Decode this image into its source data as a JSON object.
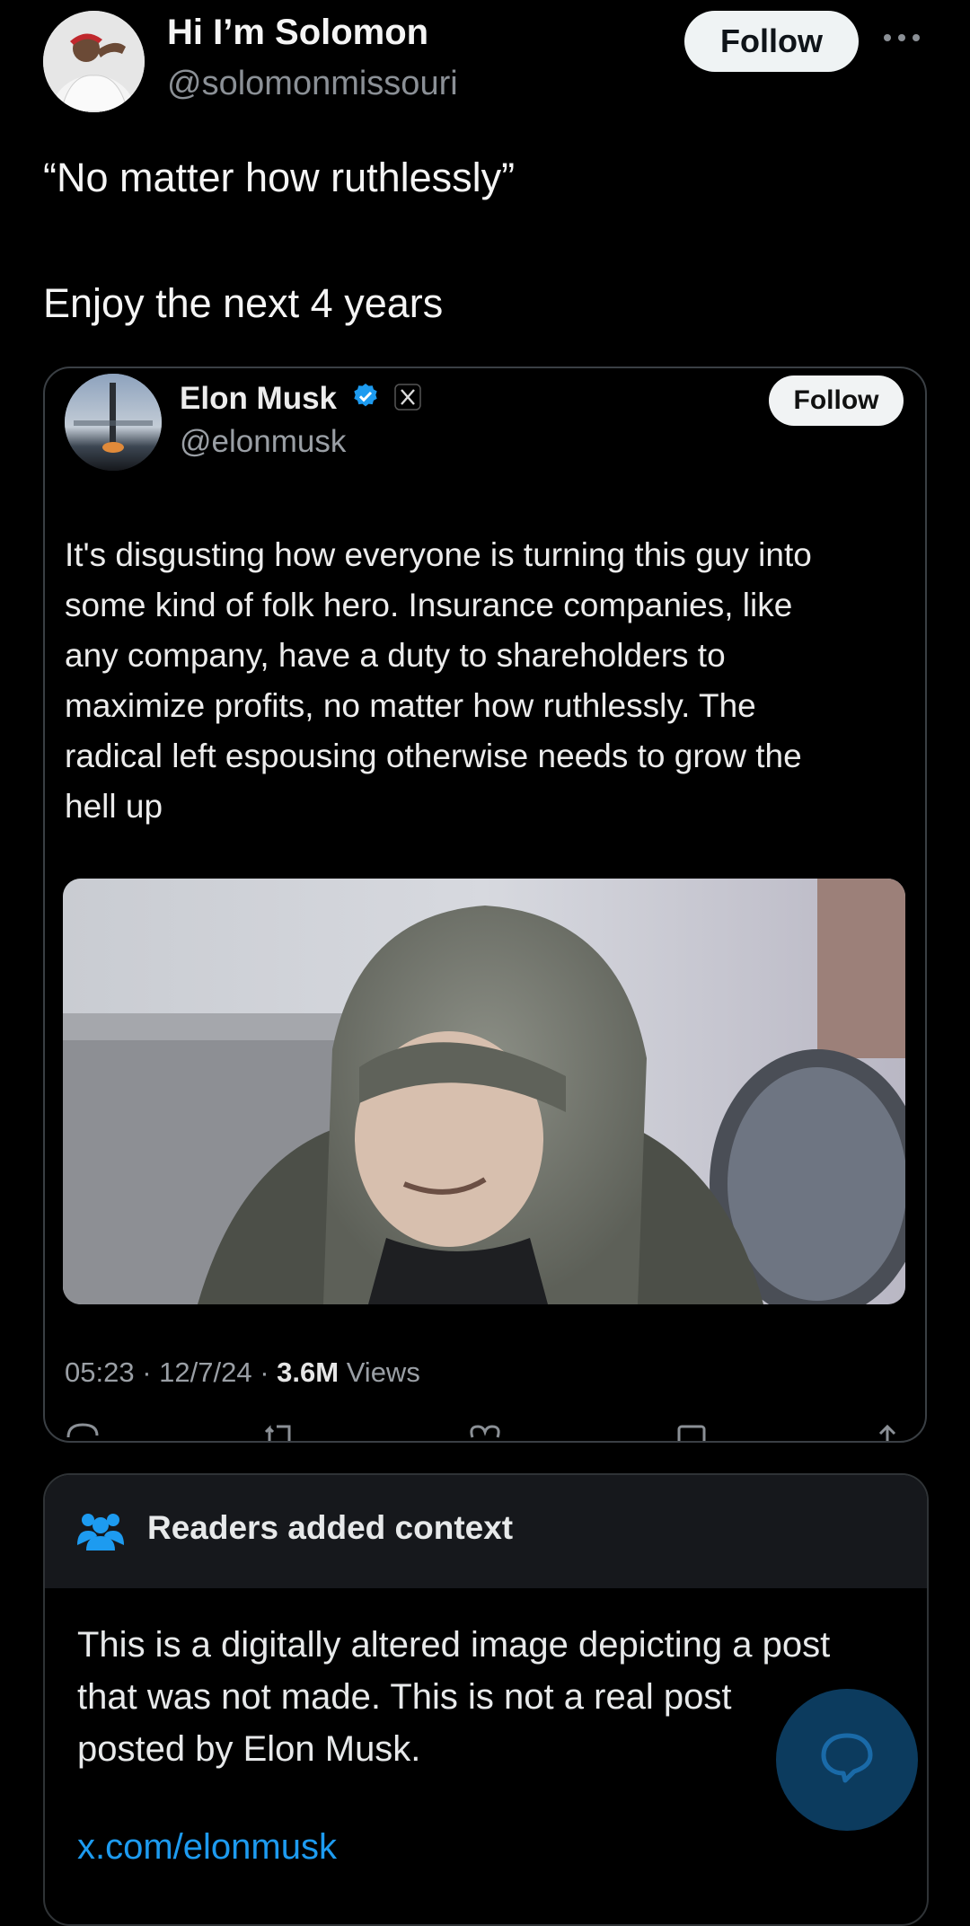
{
  "post": {
    "author_name": "Hi I’m Solomon",
    "author_handle": "@solomonmissouri",
    "follow_label": "Follow",
    "more_icon": "more-horizontal-icon",
    "text_line1": "“No matter how ruthlessly”",
    "text_line2": "Enjoy the next 4 years"
  },
  "quoted": {
    "name": "Elon Musk",
    "handle": "@elonmusk",
    "follow_label": "Follow",
    "verified_icon": "verified-badge-icon",
    "affiliate_icon": "x-logo-icon",
    "text_lines": [
      "It's disgusting how everyone is turning this guy into",
      "some kind of folk hero. Insurance companies, like",
      "any company, have a duty to shareholders to",
      "maximize profits, no matter how ruthlessly. The",
      "radical left espousing otherwise needs to grow the",
      "hell up"
    ],
    "time": "05:23",
    "date": "12/7/24",
    "views_count": "3.6M",
    "views_label": "Views"
  },
  "note": {
    "title": "Readers added context",
    "body_lines": [
      "This is a digitally altered image depicting a post",
      "that was not made. This is not a real post",
      "posted by Elon Musk."
    ],
    "link": "x.com/elonmusk"
  },
  "colors": {
    "background": "#000000",
    "link": "#1d9bf0",
    "verified": "#1d9bf0",
    "note_header": "#16181c",
    "fab": "#0c3b5e"
  }
}
